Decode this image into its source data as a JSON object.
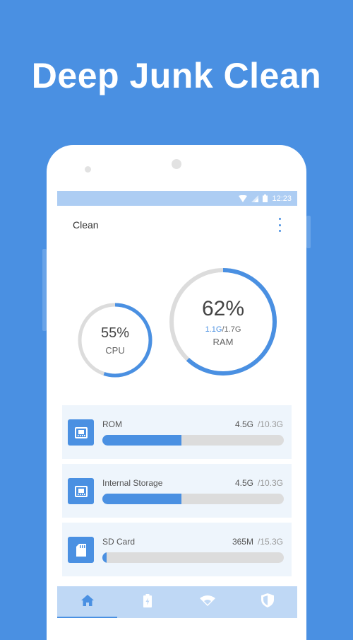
{
  "headline": "Deep Junk Clean",
  "status_bar": {
    "time": "12:23"
  },
  "app": {
    "title": "Clean",
    "menu_icon": "more-vert-icon"
  },
  "gauges": {
    "cpu": {
      "percent": "55%",
      "label": "CPU",
      "fraction": 0.55
    },
    "ram": {
      "percent": "62%",
      "used": "1.1G",
      "total": "1.7G",
      "separator": "/",
      "label": "RAM",
      "fraction": 0.62
    }
  },
  "storage": [
    {
      "name": "ROM",
      "used": "4.5G",
      "total": "/10.3G",
      "fraction": 0.437,
      "icon": "chip-icon"
    },
    {
      "name": "Internal Storage",
      "used": "4.5G",
      "total": "/10.3G",
      "fraction": 0.437,
      "icon": "chip-icon"
    },
    {
      "name": "SD Card",
      "used": "365M",
      "total": "/15.3G",
      "fraction": 0.023,
      "icon": "sd-card-icon"
    }
  ],
  "bottom_nav": [
    {
      "name": "home",
      "icon": "home-icon",
      "active": true
    },
    {
      "name": "battery",
      "icon": "battery-icon",
      "active": false
    },
    {
      "name": "wifi",
      "icon": "wifi-icon",
      "active": false
    },
    {
      "name": "security",
      "icon": "shield-icon",
      "active": false
    }
  ],
  "colors": {
    "brand": "#4A90E2",
    "track": "#DCDCDC",
    "card_bg": "#EEF5FC",
    "nav_bg": "#BFD8F5"
  }
}
